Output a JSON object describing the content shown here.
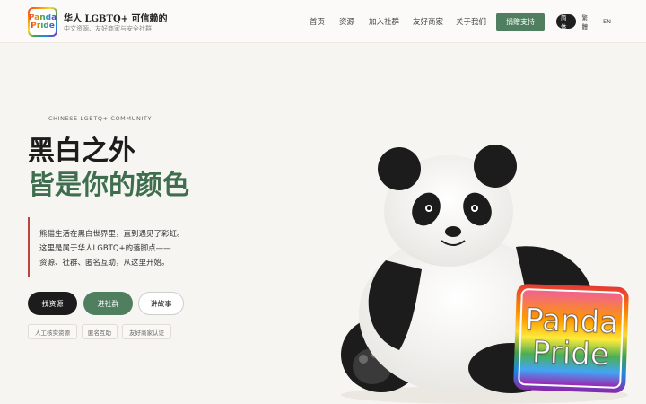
{
  "header": {
    "logo_line1": "Panda",
    "logo_line2": "Pride",
    "brand_title": "华人 LGBTQ+ 可信赖的",
    "brand_subtitle": "中文资源、友好商家与安全社群",
    "nav": [
      "首页",
      "资源",
      "加入社群",
      "友好商家",
      "关于我们"
    ],
    "donate_label": "捐赠支持",
    "languages": [
      "简体",
      "繁體",
      "EN"
    ],
    "active_language": "简体"
  },
  "hero": {
    "eyebrow": "CHINESE LGBTQ+ COMMUNITY",
    "headline_line1": "黑白之外",
    "headline_line2": "皆是你的颜色",
    "description": [
      "熊猫生活在黑白世界里，直到遇见了彩虹。",
      "这里是属于华人LGBTQ+的落脚点——",
      "资源、社群、匿名互助，从这里开始。"
    ],
    "buttons": {
      "find_resources": "找资源",
      "join_community": "进社群",
      "tell_story": "讲故事"
    },
    "tags": [
      "人工核实资源",
      "匿名互助",
      "友好商家认证"
    ]
  },
  "illustration": {
    "sign_line1": "Panda",
    "sign_line2": "Pride"
  },
  "colors": {
    "accent_green": "#4f7f5f",
    "headline_green": "#3f6e4f",
    "accent_red": "#b9473e",
    "dark": "#1c1c1c"
  }
}
